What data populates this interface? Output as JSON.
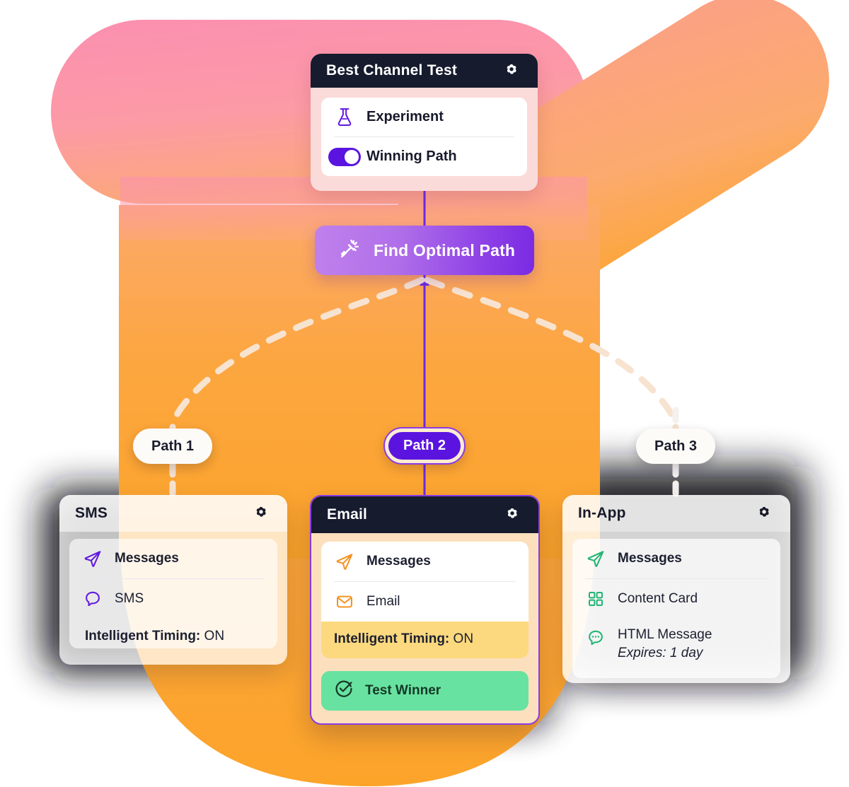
{
  "colors": {
    "dark_header": "#161b2e",
    "purple": "#5b14e0",
    "purple_border": "#8a3be4",
    "orange_icon": "#f59323",
    "green_icon": "#22b573",
    "green_badge": "#68e2a1",
    "yellow_band": "#fcd97e",
    "pink_blob": "#f98fae",
    "orange_blob": "#fca22c",
    "dashed_line": "#f7e3d0"
  },
  "experiment_card": {
    "title": "Best Channel Test",
    "gear_icon": "gear-icon",
    "rows": [
      {
        "icon": "flask-icon",
        "label": "Experiment"
      },
      {
        "icon": "toggle-on-icon",
        "label": "Winning Path"
      }
    ]
  },
  "find_button": {
    "label": "Find Optimal Path",
    "icon": "magic-wand-icon"
  },
  "paths": [
    {
      "id": "path1",
      "label": "Path 1",
      "selected": false
    },
    {
      "id": "path2",
      "label": "Path 2",
      "selected": true
    },
    {
      "id": "path3",
      "label": "Path 3",
      "selected": false
    }
  ],
  "sms_card": {
    "title": "SMS",
    "gear_icon": "gear-icon",
    "rows": [
      {
        "icon": "send-icon",
        "label": "Messages"
      },
      {
        "icon": "chat-bubble-icon",
        "label": "SMS"
      }
    ],
    "timing_label": "Intelligent Timing:",
    "timing_value": "ON"
  },
  "email_card": {
    "title": "Email",
    "gear_icon": "gear-icon",
    "rows": [
      {
        "icon": "send-icon",
        "label": "Messages"
      },
      {
        "icon": "envelope-icon",
        "label": "Email"
      }
    ],
    "timing_label": "Intelligent Timing:",
    "timing_value": "ON",
    "winner_label": "Test Winner",
    "winner_icon": "check-circle-icon"
  },
  "inapp_card": {
    "title": "In-App",
    "gear_icon": "gear-icon",
    "rows": [
      {
        "icon": "send-icon",
        "label": "Messages"
      },
      {
        "icon": "grid-icon",
        "label": "Content Card"
      },
      {
        "icon": "chat-dots-icon",
        "label": "HTML Message"
      }
    ],
    "expires": "Expires: 1 day"
  }
}
